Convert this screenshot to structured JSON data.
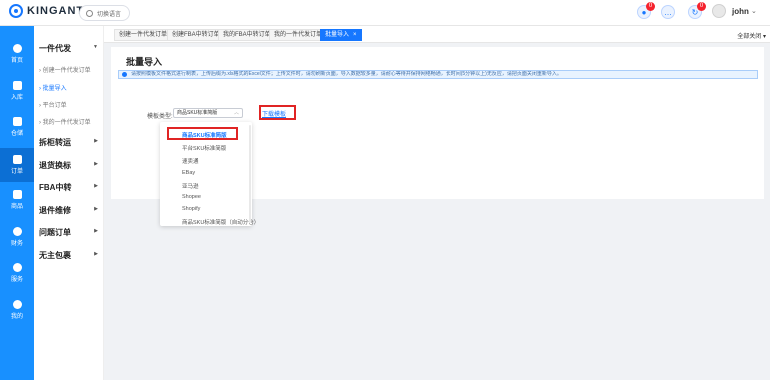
{
  "header": {
    "logo_text": "KINGANT",
    "lang_button": "切换语言",
    "notifications": [
      {
        "icon": "bell-icon",
        "badge": "0"
      },
      {
        "icon": "chat-icon",
        "badge": ""
      },
      {
        "icon": "refresh-icon",
        "badge": "0"
      }
    ],
    "user_name": "john",
    "user_chevron": "⌄"
  },
  "leftnav": {
    "items": [
      {
        "label": "首页",
        "icon": "home-icon"
      },
      {
        "label": "入库",
        "icon": "inbound-icon"
      },
      {
        "label": "仓储",
        "icon": "warehouse-icon"
      },
      {
        "label": "订单",
        "icon": "order-icon",
        "active": true
      },
      {
        "label": "商品",
        "icon": "product-icon"
      },
      {
        "label": "财务",
        "icon": "finance-icon"
      },
      {
        "label": "服务",
        "icon": "service-icon"
      },
      {
        "label": "我的",
        "icon": "user-icon"
      }
    ]
  },
  "submenu": {
    "group_dropship": "一件代发",
    "items": [
      "创建一件代发订单",
      "批量导入",
      "平台订单",
      "我的一件代发订单"
    ],
    "group_transfer": "拆柜转运",
    "group_return": "退货换标",
    "group_fba": "FBA中转",
    "group_repair": "退件维修",
    "group_issue": "问题订单",
    "group_noname": "无主包裹"
  },
  "tabs": {
    "items": [
      "创建一件代发订单",
      "创建FBA中转订单",
      "我的FBA中转订单",
      "我的一件代发订单",
      "批量导入"
    ],
    "close_icon": "×",
    "close_all": "全部关闭"
  },
  "main": {
    "title": "批量导入",
    "notice": "请按照模板文件格式进行制表，上传后缀为.xls格式的Excel文件；上传文件时，请勿刷新页面，导入数据较多量，请耐心等待并保持网络畅通，长时间(5分钟以上)无反应，请把页面关闭重新导入。",
    "template_label": "模板类型:",
    "template_value": "商品SKU标准简版",
    "download_link": "下载模板"
  },
  "dropdown": {
    "options": [
      "商品SKU标准简版",
      "平台SKU标准简版",
      "速卖通",
      "EBay",
      "亚马逊",
      "Shopee",
      "Shopify",
      "商品SKU标准简版（自动分仓）"
    ]
  },
  "colors": {
    "primary": "#1677ff",
    "nav": "#1890ff",
    "highlight": "#e02424"
  }
}
